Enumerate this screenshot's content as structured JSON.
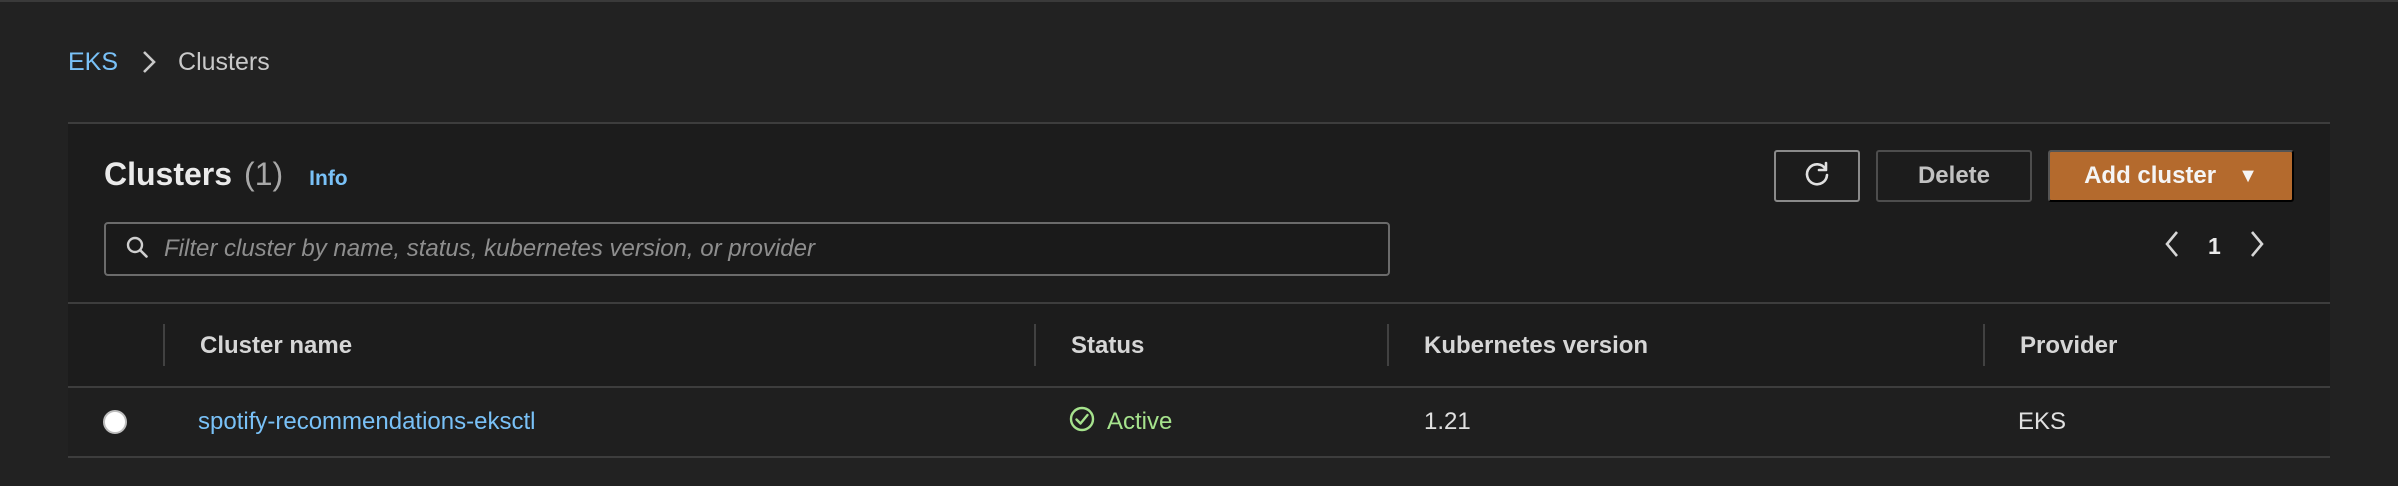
{
  "breadcrumb": {
    "root": "EKS",
    "current": "Clusters"
  },
  "header": {
    "title": "Clusters",
    "count": "(1)",
    "info": "Info"
  },
  "toolbar": {
    "refresh_icon": "refresh-icon",
    "delete_label": "Delete",
    "add_label": "Add cluster",
    "add_caret": "▼"
  },
  "search": {
    "placeholder": "Filter cluster by name, status, kubernetes version, or provider",
    "value": ""
  },
  "pagination": {
    "current_page": "1"
  },
  "table": {
    "columns": [
      "Cluster name",
      "Status",
      "Kubernetes version",
      "Provider"
    ],
    "rows": [
      {
        "selected": false,
        "name": "spotify-recommendations-eksctl",
        "status": "Active",
        "version": "1.21",
        "provider": "EKS"
      }
    ]
  },
  "colors": {
    "background": "#222222",
    "link": "#79c1f7",
    "primary_button": "#b46a2d",
    "status_active": "#a6e38d"
  }
}
